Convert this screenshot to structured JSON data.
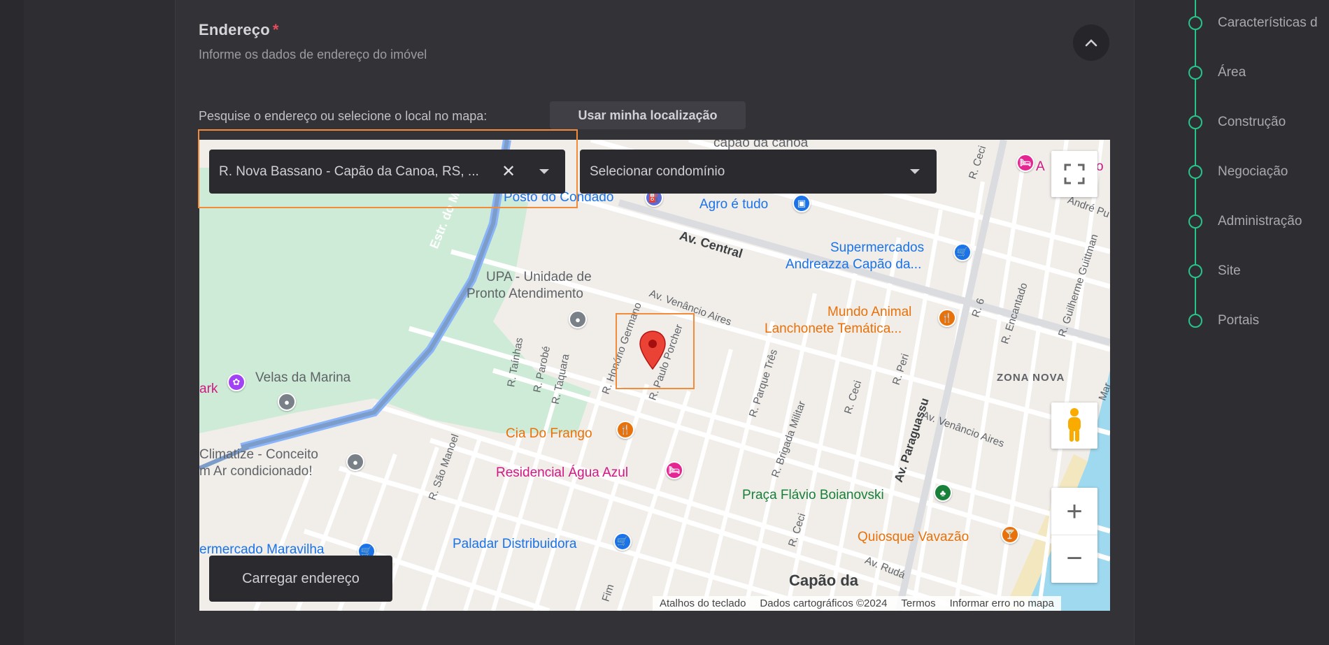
{
  "section": {
    "title": "Endereço",
    "required_mark": "*",
    "subtitle": "Informe os dados de endereço do imóvel"
  },
  "search": {
    "label": "Pesquise o endereço ou selecione o local no mapa:",
    "use_location_label": "Usar minha localização",
    "address_value": "R. Nova Bassano - Capão da Canoa, RS, ...",
    "clear_symbol": "✕",
    "condo_placeholder": "Selecionar condomínio"
  },
  "map": {
    "labels": {
      "capao_top": "capão da canoa",
      "posto": "Posto do Condado",
      "agro": "Agro é tudo",
      "av_central": "Av. Central",
      "superm1": "Supermercados",
      "superm2": "Andreazza Capão da...",
      "upa1": "UPA - Unidade de",
      "upa2": "Pronto Atendimento",
      "mundo1": "Mundo Animal",
      "mundo2": "Lanchonete Temática...",
      "velas": "Velas da Marina",
      "ark": "ark",
      "climatize1": "Climatize - Conceito",
      "climatize2": "m Ar condicionado!",
      "cia": "Cia Do Frango",
      "residencial": "Residencial Água Azul",
      "praca": "Praça Flávio Boianovski",
      "quiosque": "Quiosque Vavazão",
      "paladar": "Paladar Distribuidora",
      "maravilha": "ermercado Maravilha",
      "capao_bottom": "Capão da",
      "zona_nova": "ZONA NOVA",
      "hotel_a": "A",
      "hotel_o": "o"
    },
    "streets": {
      "estr": "Estr. do Ma",
      "av_venancio": "Av. Venâncio Aires",
      "av_venancio2": "Av. Venâncio Aires",
      "honorio": "R. Honório Germano",
      "paulo": "R. Paulo Porcher",
      "tainhas": "R. Taínhas",
      "parobe": "R. Parobé",
      "taquara": "R. Taquara",
      "parque": "R. Parque Três",
      "brigada": "R. Brigada Militar",
      "ceci1": "R. Ceci",
      "ceci2": "R. Ceci",
      "ceci3": "R. Ceci",
      "peri": "R. Peri",
      "paraguassu": "Av. Paraguassu",
      "encantado": "R. Encantado",
      "guilherme": "R. Guilherme Guittman",
      "r6": "R. 6",
      "andre": "André Pu",
      "sao_manoel": "R. São Manoel",
      "ruda": "Av. Rudá",
      "mar": "Mar",
      "fim": "Fim"
    },
    "attribution": {
      "shortcuts": "Atalhos do teclado",
      "data": "Dados cartográficos ©2024",
      "terms": "Termos",
      "report": "Informar erro no mapa"
    },
    "zoom_in": "+",
    "zoom_out": "−",
    "load_address_label": "Carregar endereço"
  },
  "steps": [
    {
      "label": "Características d"
    },
    {
      "label": "Área"
    },
    {
      "label": "Construção"
    },
    {
      "label": "Negociação"
    },
    {
      "label": "Administração"
    },
    {
      "label": "Site"
    },
    {
      "label": "Portais"
    }
  ],
  "colors": {
    "accent_green": "#27c48a",
    "highlight_orange": "#f28c3a",
    "required_red": "#e74c5c",
    "pin_red": "#ea4335"
  }
}
